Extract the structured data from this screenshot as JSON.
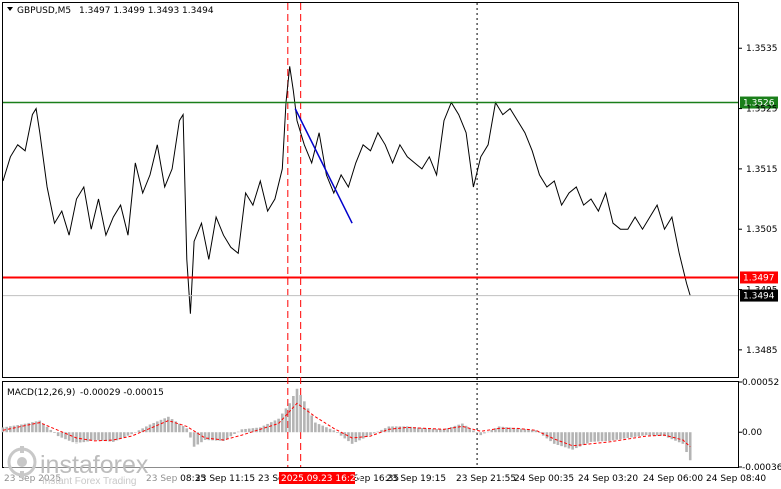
{
  "header": {
    "symbol": "GBPUSD,M5",
    "ohlc": "1.3497 1.3499 1.3493 1.3494"
  },
  "macd_header": {
    "label": "MACD(12,26,9)",
    "values": "-0.00029 -0.00015"
  },
  "colors": {
    "price_line": "#000000",
    "green_level": "#1a7f1a",
    "red_level": "#ff0000",
    "trend_line": "#0000cc",
    "macd_hist": "#b4b4b4",
    "macd_signal": "#ff0000",
    "label_red_bg": "#ff0000",
    "label_green_bg": "#1a7f1a"
  },
  "chart_data": {
    "type": "line",
    "price_axis": {
      "ylim": [
        1.34805,
        1.35425
      ],
      "ticks": [
        "1.3535",
        "1.3525",
        "1.3515",
        "1.3505",
        "1.3495",
        "1.3485"
      ],
      "tick_values": [
        1.3535,
        1.3525,
        1.3515,
        1.3505,
        1.3495,
        1.3485
      ]
    },
    "levels": [
      {
        "price": 1.3526,
        "label": "1.3526",
        "color": "green"
      },
      {
        "price": 1.3497,
        "label": "1.3497",
        "color": "red"
      }
    ],
    "current_price": {
      "price": 1.3494,
      "label": "1.3494"
    },
    "time_labels": [
      "23 Sep 2025",
      "23 Sep 08:35",
      "23 Sep 11:15",
      "23 Sep 13:55",
      "2025.09.23 16:20",
      "23 Sep 16:35",
      "23 Sep 19:15",
      "23 Sep 21:55",
      "24 Sep 00:35",
      "24 Sep 03:20",
      "24 Sep 06:00",
      "24 Sep 08:40"
    ],
    "highlighted_time": "2025.09.23 16:20",
    "x_range": [
      0,
      200
    ],
    "price_series": [
      [
        0,
        1.3513
      ],
      [
        2,
        1.3517
      ],
      [
        4,
        1.3519
      ],
      [
        6,
        1.3518
      ],
      [
        8,
        1.3524
      ],
      [
        9,
        1.3525
      ],
      [
        10,
        1.3521
      ],
      [
        12,
        1.3512
      ],
      [
        14,
        1.3506
      ],
      [
        16,
        1.3508
      ],
      [
        18,
        1.3504
      ],
      [
        20,
        1.351
      ],
      [
        22,
        1.3512
      ],
      [
        24,
        1.3505
      ],
      [
        26,
        1.351
      ],
      [
        28,
        1.3504
      ],
      [
        30,
        1.3507
      ],
      [
        32,
        1.3509
      ],
      [
        34,
        1.3504
      ],
      [
        36,
        1.3516
      ],
      [
        38,
        1.3511
      ],
      [
        40,
        1.3514
      ],
      [
        42,
        1.3519
      ],
      [
        44,
        1.3512
      ],
      [
        46,
        1.3515
      ],
      [
        48,
        1.3523
      ],
      [
        49,
        1.3524
      ],
      [
        50,
        1.35
      ],
      [
        51,
        1.3491
      ],
      [
        52,
        1.3503
      ],
      [
        54,
        1.3506
      ],
      [
        56,
        1.35
      ],
      [
        58,
        1.3507
      ],
      [
        60,
        1.3504
      ],
      [
        62,
        1.3502
      ],
      [
        64,
        1.3501
      ],
      [
        66,
        1.3511
      ],
      [
        68,
        1.3509
      ],
      [
        70,
        1.3513
      ],
      [
        72,
        1.3508
      ],
      [
        74,
        1.351
      ],
      [
        76,
        1.3515
      ],
      [
        77,
        1.3526
      ],
      [
        78,
        1.3532
      ],
      [
        79,
        1.3528
      ],
      [
        80,
        1.3523
      ],
      [
        82,
        1.3519
      ],
      [
        84,
        1.3516
      ],
      [
        86,
        1.3521
      ],
      [
        88,
        1.3514
      ],
      [
        90,
        1.3511
      ],
      [
        92,
        1.3514
      ],
      [
        94,
        1.3512
      ],
      [
        96,
        1.3516
      ],
      [
        98,
        1.3519
      ],
      [
        100,
        1.3518
      ],
      [
        102,
        1.3521
      ],
      [
        104,
        1.3519
      ],
      [
        106,
        1.3516
      ],
      [
        108,
        1.3519
      ],
      [
        110,
        1.3517
      ],
      [
        112,
        1.3516
      ],
      [
        114,
        1.3515
      ],
      [
        116,
        1.3517
      ],
      [
        118,
        1.3514
      ],
      [
        120,
        1.3523
      ],
      [
        122,
        1.3526
      ],
      [
        124,
        1.3524
      ],
      [
        126,
        1.3521
      ],
      [
        128,
        1.3512
      ],
      [
        130,
        1.3517
      ],
      [
        132,
        1.3519
      ],
      [
        134,
        1.3526
      ],
      [
        136,
        1.3524
      ],
      [
        138,
        1.3525
      ],
      [
        140,
        1.3523
      ],
      [
        142,
        1.3521
      ],
      [
        144,
        1.3518
      ],
      [
        146,
        1.3514
      ],
      [
        148,
        1.3512
      ],
      [
        150,
        1.3513
      ],
      [
        152,
        1.3509
      ],
      [
        154,
        1.3511
      ],
      [
        156,
        1.3512
      ],
      [
        158,
        1.3509
      ],
      [
        160,
        1.351
      ],
      [
        162,
        1.3508
      ],
      [
        164,
        1.3511
      ],
      [
        166,
        1.3506
      ],
      [
        168,
        1.3505
      ],
      [
        170,
        1.3505
      ],
      [
        172,
        1.3507
      ],
      [
        174,
        1.3505
      ],
      [
        176,
        1.3507
      ],
      [
        178,
        1.3509
      ],
      [
        180,
        1.3505
      ],
      [
        182,
        1.3507
      ],
      [
        184,
        1.3501
      ],
      [
        186,
        1.3496
      ],
      [
        187,
        1.3494
      ]
    ],
    "trend_line": [
      [
        79.5,
        1.3525
      ],
      [
        95,
        1.3506
      ]
    ],
    "red_vlines_x": [
      77.5,
      81
    ],
    "dotted_vline_x": [
      129
    ],
    "macd": {
      "ylim": [
        -0.00036,
        0.00052
      ],
      "ticks": [
        "0.00052",
        "0.00",
        "-0.00036"
      ],
      "tick_values": [
        0.00052,
        0.0,
        -0.00036
      ],
      "histogram": [
        [
          0,
          5e-05
        ],
        [
          5,
          8e-05
        ],
        [
          10,
          0.00012
        ],
        [
          15,
          -4e-05
        ],
        [
          20,
          -0.00012
        ],
        [
          25,
          -8e-05
        ],
        [
          30,
          -0.0001
        ],
        [
          35,
          -2e-05
        ],
        [
          40,
          8e-05
        ],
        [
          45,
          0.00016
        ],
        [
          50,
          4e-05
        ],
        [
          52,
          -0.00015
        ],
        [
          55,
          -8e-05
        ],
        [
          60,
          -9e-05
        ],
        [
          65,
          3e-05
        ],
        [
          70,
          5e-05
        ],
        [
          75,
          0.00014
        ],
        [
          78,
          0.0003
        ],
        [
          80,
          0.00045
        ],
        [
          82,
          0.00032
        ],
        [
          85,
          0.0001
        ],
        [
          90,
          2e-05
        ],
        [
          95,
          -0.00012
        ],
        [
          100,
          -3e-05
        ],
        [
          105,
          6e-05
        ],
        [
          110,
          6e-05
        ],
        [
          115,
          4e-05
        ],
        [
          120,
          3e-05
        ],
        [
          125,
          9e-05
        ],
        [
          130,
          -3e-05
        ],
        [
          135,
          6e-05
        ],
        [
          140,
          4e-05
        ],
        [
          145,
          2e-05
        ],
        [
          150,
          -0.00012
        ],
        [
          155,
          -0.00018
        ],
        [
          160,
          -0.0001
        ],
        [
          165,
          -9e-05
        ],
        [
          170,
          -6e-05
        ],
        [
          175,
          -3e-05
        ],
        [
          180,
          -4e-05
        ],
        [
          185,
          -0.00012
        ],
        [
          187,
          -0.00029
        ]
      ],
      "signal": [
        [
          0,
          2e-05
        ],
        [
          5,
          6e-05
        ],
        [
          10,
          0.0001
        ],
        [
          15,
          2e-05
        ],
        [
          20,
          -6e-05
        ],
        [
          25,
          -9e-05
        ],
        [
          30,
          -8e-05
        ],
        [
          35,
          -4e-05
        ],
        [
          40,
          4e-05
        ],
        [
          45,
          0.00012
        ],
        [
          50,
          6e-05
        ],
        [
          55,
          -6e-05
        ],
        [
          60,
          -8e-05
        ],
        [
          65,
          -3e-05
        ],
        [
          70,
          3e-05
        ],
        [
          75,
          9e-05
        ],
        [
          80,
          0.0003
        ],
        [
          85,
          0.00016
        ],
        [
          90,
          4e-05
        ],
        [
          95,
          -6e-05
        ],
        [
          100,
          -4e-05
        ],
        [
          105,
          3e-05
        ],
        [
          110,
          5e-05
        ],
        [
          115,
          4e-05
        ],
        [
          120,
          3e-05
        ],
        [
          125,
          6e-05
        ],
        [
          130,
          1e-05
        ],
        [
          135,
          4e-05
        ],
        [
          140,
          4e-05
        ],
        [
          145,
          2e-05
        ],
        [
          150,
          -7e-05
        ],
        [
          155,
          -0.00014
        ],
        [
          160,
          -0.00012
        ],
        [
          165,
          -0.0001
        ],
        [
          170,
          -7e-05
        ],
        [
          175,
          -4e-05
        ],
        [
          180,
          -3e-05
        ],
        [
          185,
          -8e-05
        ],
        [
          187,
          -0.00015
        ]
      ]
    }
  },
  "watermark": {
    "brand": "instaforex",
    "tagline": "Instant Forex Trading"
  }
}
